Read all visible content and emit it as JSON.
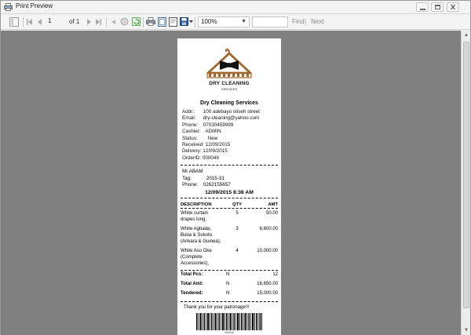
{
  "window": {
    "title": "Print Preview"
  },
  "toolbar": {
    "page_current": "1",
    "page_of": "of 1",
    "zoom": "100%",
    "find_label": "Find",
    "separator": "|",
    "next_label": "Next"
  },
  "receipt": {
    "logo_name": "DRY CLEANING",
    "logo_sub": "SERVICES",
    "shop_name": "Dry Cleaning Services",
    "info": [
      {
        "key": "Addr.:",
        "value": "100 adebayo oliseh street"
      },
      {
        "key": "Email:",
        "value": "dry-cleaning@yahoo.com"
      },
      {
        "key": "Phone:",
        "value": "07030459999"
      },
      {
        "key": "Cashier:",
        "value": "ADMIN"
      },
      {
        "key": "Status:",
        "value": "New"
      },
      {
        "key": "Received:",
        "value": "12/09/2015"
      },
      {
        "key": "Delivery:",
        "value": "12/09/2015"
      },
      {
        "key": "OrderID:",
        "value": "000049"
      }
    ],
    "customer": {
      "name": "Mr.ABAM",
      "tag_key": "Tag:",
      "tag": "2015-31",
      "phone_key": "Phone:",
      "phone": "0262155657"
    },
    "datetime": "12/09/2015 8:38 AM",
    "columns": {
      "desc": "DESCRIPTION",
      "qty": "QTY",
      "amt": "AMT"
    },
    "items": [
      {
        "desc_lines": [
          "White curtain",
          "drapes long,"
        ],
        "qty": "5",
        "amt": "50.00"
      },
      {
        "desc_lines": [
          "White Agbada,",
          "Buba & Sokoto",
          "(Ankara & Guinea),"
        ],
        "qty": "3",
        "amt": "6,600.00"
      },
      {
        "desc_lines": [
          "White Aso Oke",
          "(Complete",
          "Accessories),"
        ],
        "qty": "4",
        "amt": "10,000.00"
      }
    ],
    "totals": [
      {
        "label": "Total Pcs:",
        "mid": "N",
        "value": "12"
      },
      {
        "label": "Total Amt:",
        "mid": "N",
        "value": "16,650.00"
      },
      {
        "label": "Tendered:",
        "mid": "N",
        "value": "15,000.00"
      }
    ],
    "thanks": "Thank you for your patronage!!!",
    "barcode_number": "000049"
  }
}
